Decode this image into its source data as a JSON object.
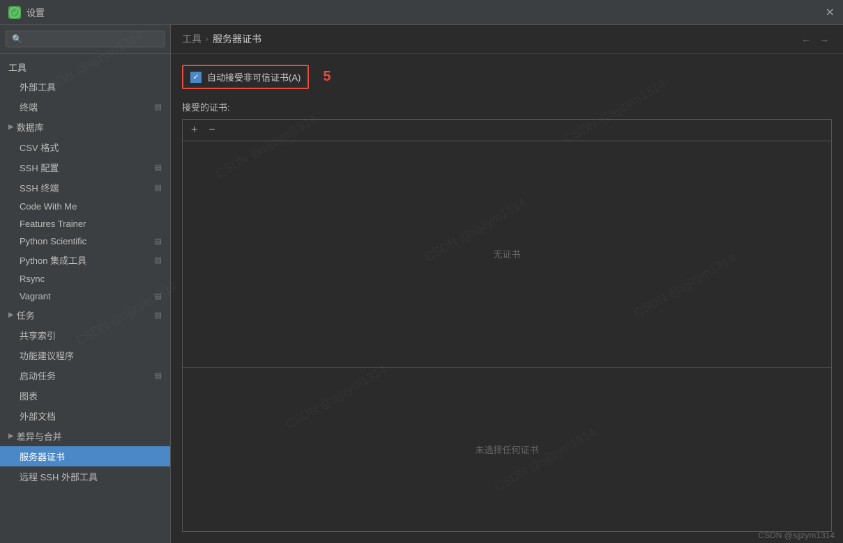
{
  "titlebar": {
    "icon_label": "P",
    "title": "设置",
    "close_label": "✕"
  },
  "search": {
    "placeholder": "🔍"
  },
  "sidebar": {
    "group_label": "工具",
    "items": [
      {
        "id": "external-tools",
        "label": "外部工具",
        "indent": true,
        "has_expand": false
      },
      {
        "id": "terminal",
        "label": "终端",
        "indent": true,
        "has_expand": true
      },
      {
        "id": "database",
        "label": "数据库",
        "indent": false,
        "has_arrow": true,
        "has_expand": false
      },
      {
        "id": "csv-format",
        "label": "CSV 格式",
        "indent": true,
        "has_expand": false
      },
      {
        "id": "ssh-config",
        "label": "SSH 配置",
        "indent": true,
        "has_expand": true
      },
      {
        "id": "ssh-terminal",
        "label": "SSH 终端",
        "indent": true,
        "has_expand": true
      },
      {
        "id": "code-with-me",
        "label": "Code With Me",
        "indent": true,
        "has_expand": false
      },
      {
        "id": "features-trainer",
        "label": "Features Trainer",
        "indent": true,
        "has_expand": false
      },
      {
        "id": "python-scientific",
        "label": "Python Scientific",
        "indent": true,
        "has_expand": true
      },
      {
        "id": "python-integrated",
        "label": "Python 集成工具",
        "indent": true,
        "has_expand": true
      },
      {
        "id": "rsync",
        "label": "Rsync",
        "indent": true,
        "has_expand": false
      },
      {
        "id": "vagrant",
        "label": "Vagrant",
        "indent": true,
        "has_expand": true
      },
      {
        "id": "tasks",
        "label": "任务",
        "indent": false,
        "has_arrow": true,
        "has_expand": true
      },
      {
        "id": "shared-index",
        "label": "共享索引",
        "indent": true,
        "has_expand": false
      },
      {
        "id": "feature-suggestion",
        "label": "功能建议程序",
        "indent": true,
        "has_expand": false
      },
      {
        "id": "startup-tasks",
        "label": "启动任务",
        "indent": true,
        "has_expand": true
      },
      {
        "id": "charts",
        "label": "图表",
        "indent": true,
        "has_expand": false
      },
      {
        "id": "external-docs",
        "label": "外部文档",
        "indent": true,
        "has_expand": false
      },
      {
        "id": "diff-merge",
        "label": "差异与合并",
        "indent": false,
        "has_arrow": true,
        "has_expand": false
      },
      {
        "id": "server-cert",
        "label": "服务器证书",
        "indent": true,
        "has_expand": false,
        "active": true
      },
      {
        "id": "remote-ssh",
        "label": "远程 SSH 外部工具",
        "indent": true,
        "has_expand": false
      }
    ]
  },
  "breadcrumb": {
    "parent": "工具",
    "separator": "›",
    "current": "服务器证书",
    "back_label": "←",
    "forward_label": "→"
  },
  "content": {
    "auto_accept_label": "自动接受非可信证书(A)",
    "number_badge": "5",
    "accepted_certs_label": "接受的证书:",
    "add_btn": "+",
    "remove_btn": "−",
    "no_cert_label": "无证书",
    "no_cert_selected_label": "未选择任何证书"
  },
  "footer": {
    "credit": "CSDN @sjjzym1314"
  }
}
